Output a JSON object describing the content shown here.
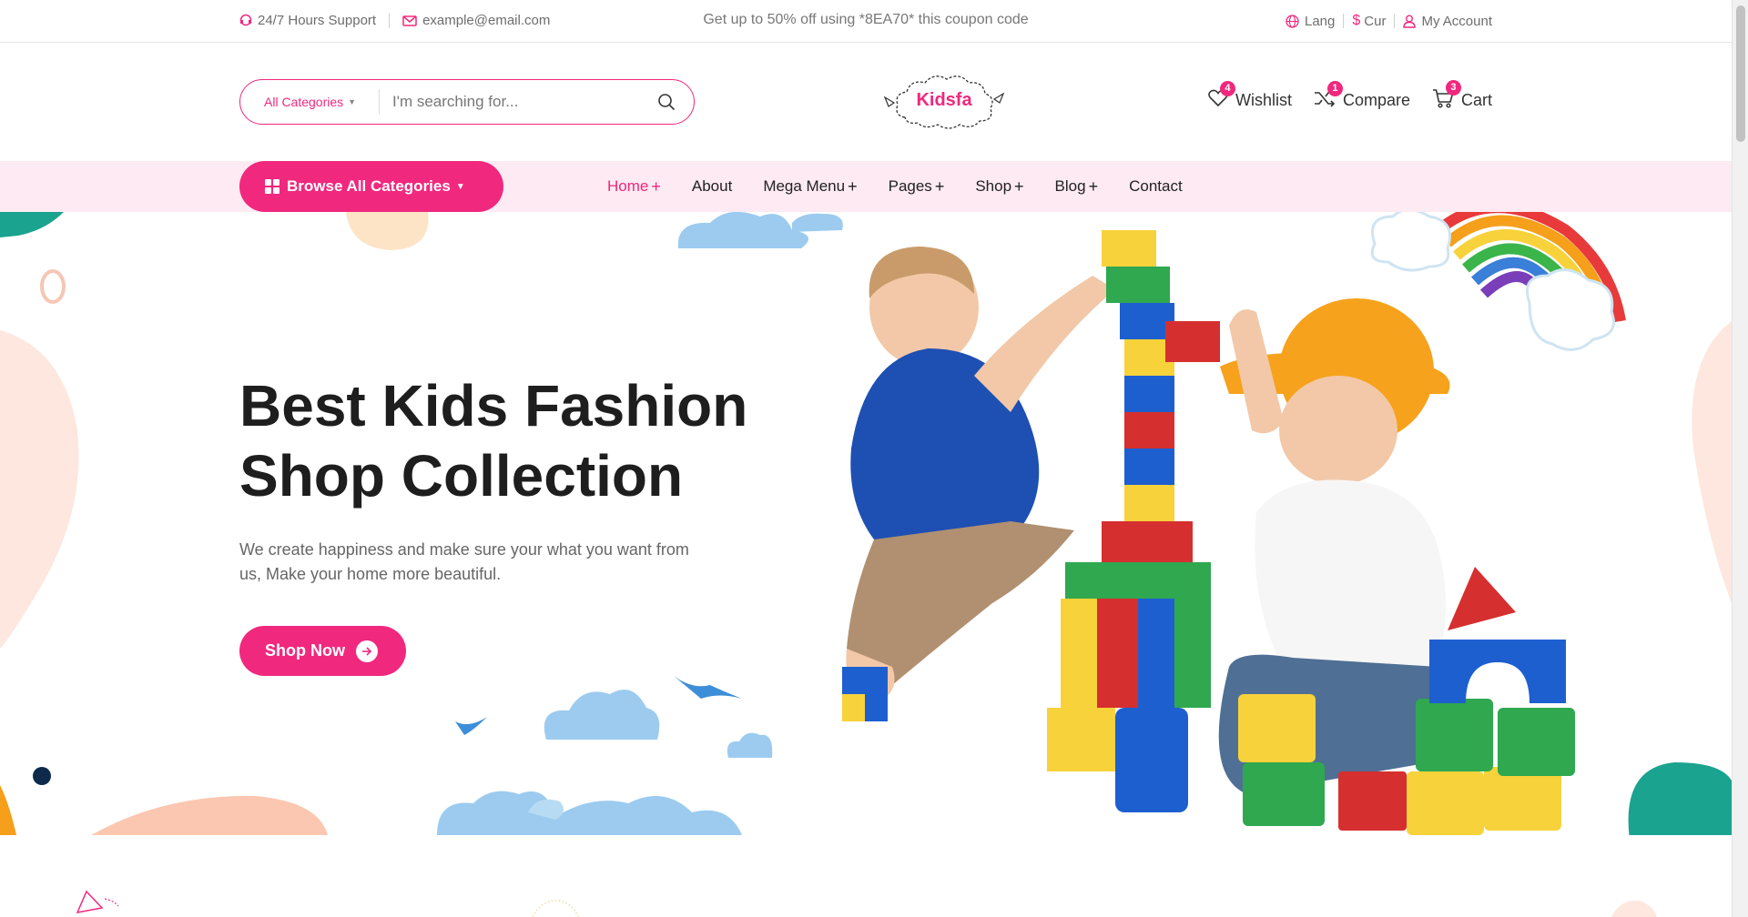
{
  "topbar": {
    "support": "24/7 Hours Support",
    "email": "example@email.com",
    "promo": "Get up to 50% off using *8EA70* this coupon code",
    "lang": "Lang",
    "currency": "Cur",
    "account": "My Account"
  },
  "search": {
    "category": "All Categories",
    "placeholder": "I'm searching for..."
  },
  "logo": {
    "text": "Kidsfa"
  },
  "header_actions": {
    "wishlist": {
      "label": "Wishlist",
      "count": "4"
    },
    "compare": {
      "label": "Compare",
      "count": "1"
    },
    "cart": {
      "label": "Cart",
      "count": "3"
    }
  },
  "nav": {
    "browse_label": "Browse All Categories",
    "items": [
      {
        "label": "Home",
        "plus": "+"
      },
      {
        "label": "About",
        "plus": ""
      },
      {
        "label": "Mega Menu",
        "plus": "+"
      },
      {
        "label": "Pages",
        "plus": "+"
      },
      {
        "label": "Shop",
        "plus": "+"
      },
      {
        "label": "Blog",
        "plus": "+"
      },
      {
        "label": "Contact",
        "plus": ""
      }
    ]
  },
  "hero": {
    "title_line1": "Best Kids Fashion",
    "title_line2": "Shop Collection",
    "description": "We create happiness and make sure your what you want from us, Make your home more beautiful.",
    "cta": "Shop Now"
  },
  "colors": {
    "accent": "#f0287e",
    "nav_bg": "#fdeaf2",
    "text_dark": "#1e1e1e",
    "teal": "#1aa38f",
    "peach": "#fbd3c3",
    "cloud_blue": "#8fc8ee"
  }
}
